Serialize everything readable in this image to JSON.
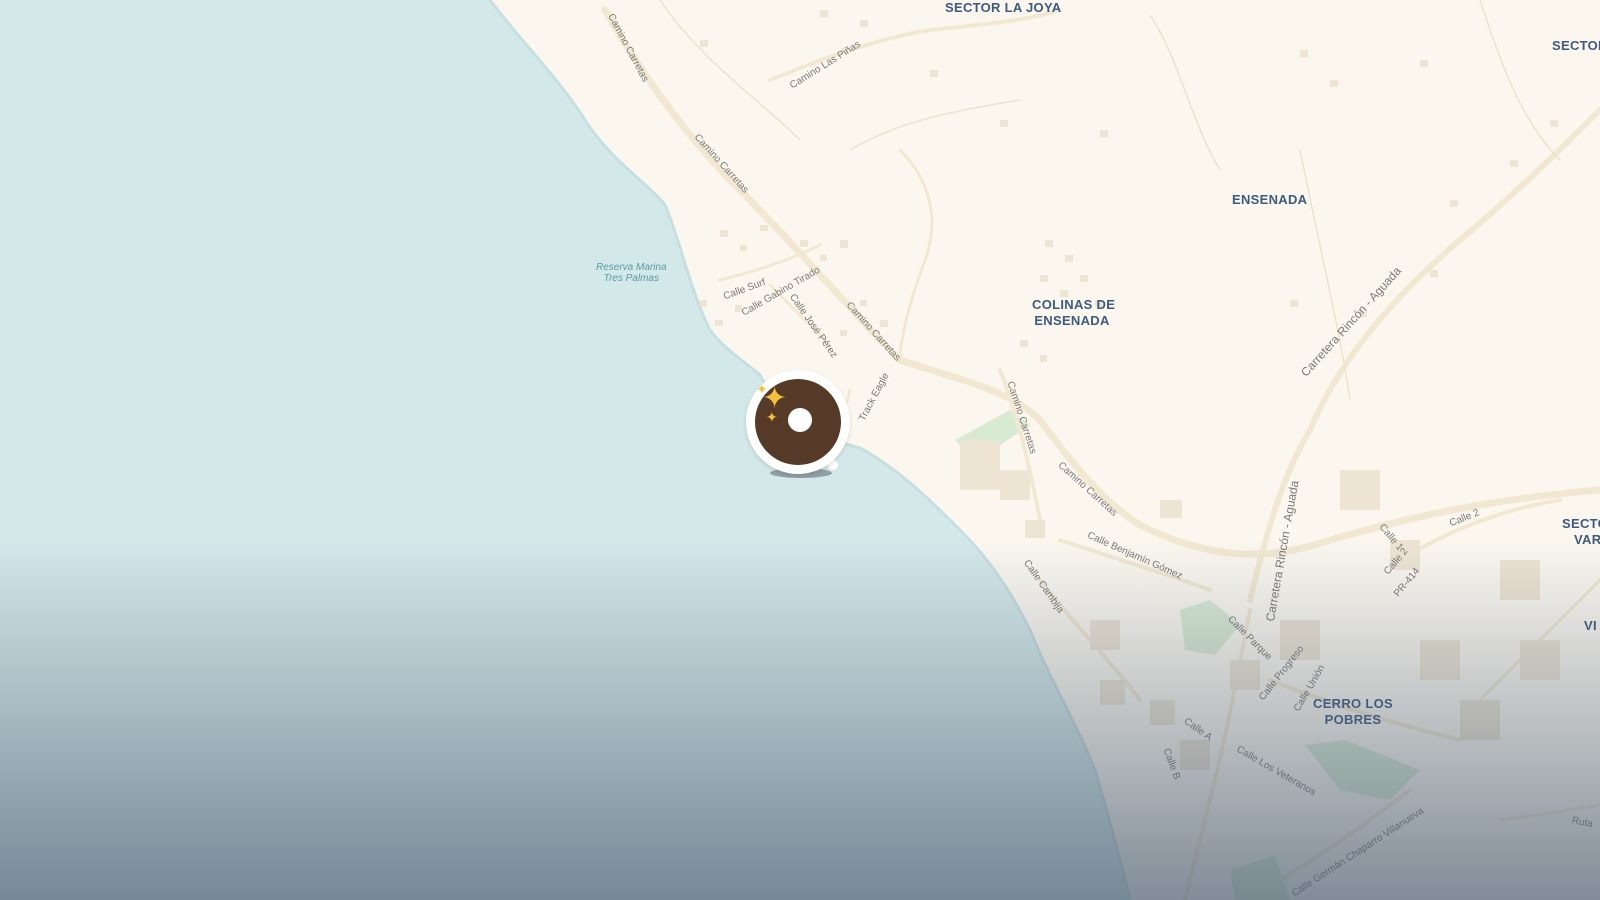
{
  "map": {
    "places": [
      {
        "id": "sector-la-joya",
        "text": "SECTOR LA JOYA"
      },
      {
        "id": "sector-right",
        "text": "SECTOR"
      },
      {
        "id": "ensenada",
        "text": "ENSENADA"
      },
      {
        "id": "colinas-1",
        "text": "COLINAS DE"
      },
      {
        "id": "colinas-2",
        "text": "ENSENADA"
      },
      {
        "id": "cerro-1",
        "text": "CERRO LOS"
      },
      {
        "id": "cerro-2",
        "text": "POBRES"
      },
      {
        "id": "secto-1",
        "text": "SECTO"
      },
      {
        "id": "secto-2",
        "text": "VAR"
      },
      {
        "id": "vi",
        "text": "VI"
      }
    ],
    "water_label": {
      "line1": "Reserva Marina",
      "line2": "Tres Palmas"
    },
    "streets": [
      "Camino Carretas",
      "Camino Las Piñas",
      "Camino Carretas",
      "Calle Surf",
      "Calle Gabino Tirado",
      "Calle José Pérez",
      "Camino Carretas",
      "Track Eagle",
      "Camino Carretas",
      "Camino Carretas",
      "Calle Benjamín Gómez",
      "Calle Cambija",
      "Carretera Rincón - Aguada",
      "Carretera Rincón - Aguada",
      "Calle 2",
      "Calle 1",
      "Calle 2",
      "PR-414",
      "Calle Parque",
      "Calle Progreso",
      "Calle Unión",
      "Calle A",
      "Calle B",
      "Calle Los Veteranos",
      "Calle Germán Chaparro Villanueva",
      "Ruta"
    ],
    "marker": {
      "name": "surf-spot-marker",
      "icon": "sparkles-icon"
    },
    "colors": {
      "water": "#d3e8e9",
      "land": "#fbf7ef",
      "road": "#f2e8d2",
      "park": "#d9ead2",
      "place_label": "#3d5a80",
      "marker": "#553b27"
    }
  }
}
